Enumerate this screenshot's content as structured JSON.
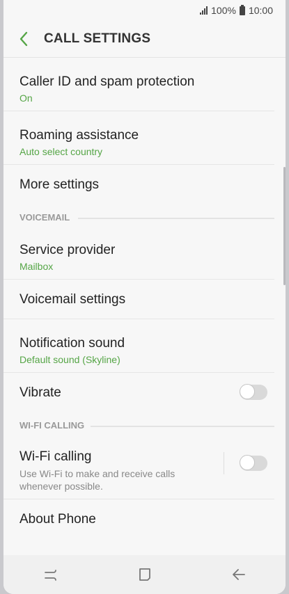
{
  "status_bar": {
    "battery": "100%",
    "time": "10:00"
  },
  "header": {
    "title": "CALL SETTINGS",
    "accent": "#55a546"
  },
  "items": {
    "caller_id": {
      "title": "Caller ID and spam protection",
      "sub": "On"
    },
    "roaming": {
      "title": "Roaming assistance",
      "sub": "Auto select country"
    },
    "more_settings": {
      "title": "More settings"
    },
    "service_provider": {
      "title": "Service provider",
      "sub": "Mailbox"
    },
    "voicemail_settings": {
      "title": "Voicemail settings"
    },
    "notification_sound": {
      "title": "Notification sound",
      "sub": "Default sound (Skyline)"
    },
    "vibrate": {
      "title": "Vibrate",
      "toggle": "off"
    },
    "wifi_calling": {
      "title": "Wi-Fi calling",
      "desc": "Use Wi-Fi to make and receive calls whenever possible.",
      "toggle": "off"
    },
    "about_phone": {
      "title": "About Phone"
    }
  },
  "sections": {
    "voicemail": "VOICEMAIL",
    "wifi_calling": "WI-FI CALLING"
  },
  "nav": {
    "icons": [
      "recent-apps-icon",
      "home-icon",
      "back-icon"
    ]
  }
}
